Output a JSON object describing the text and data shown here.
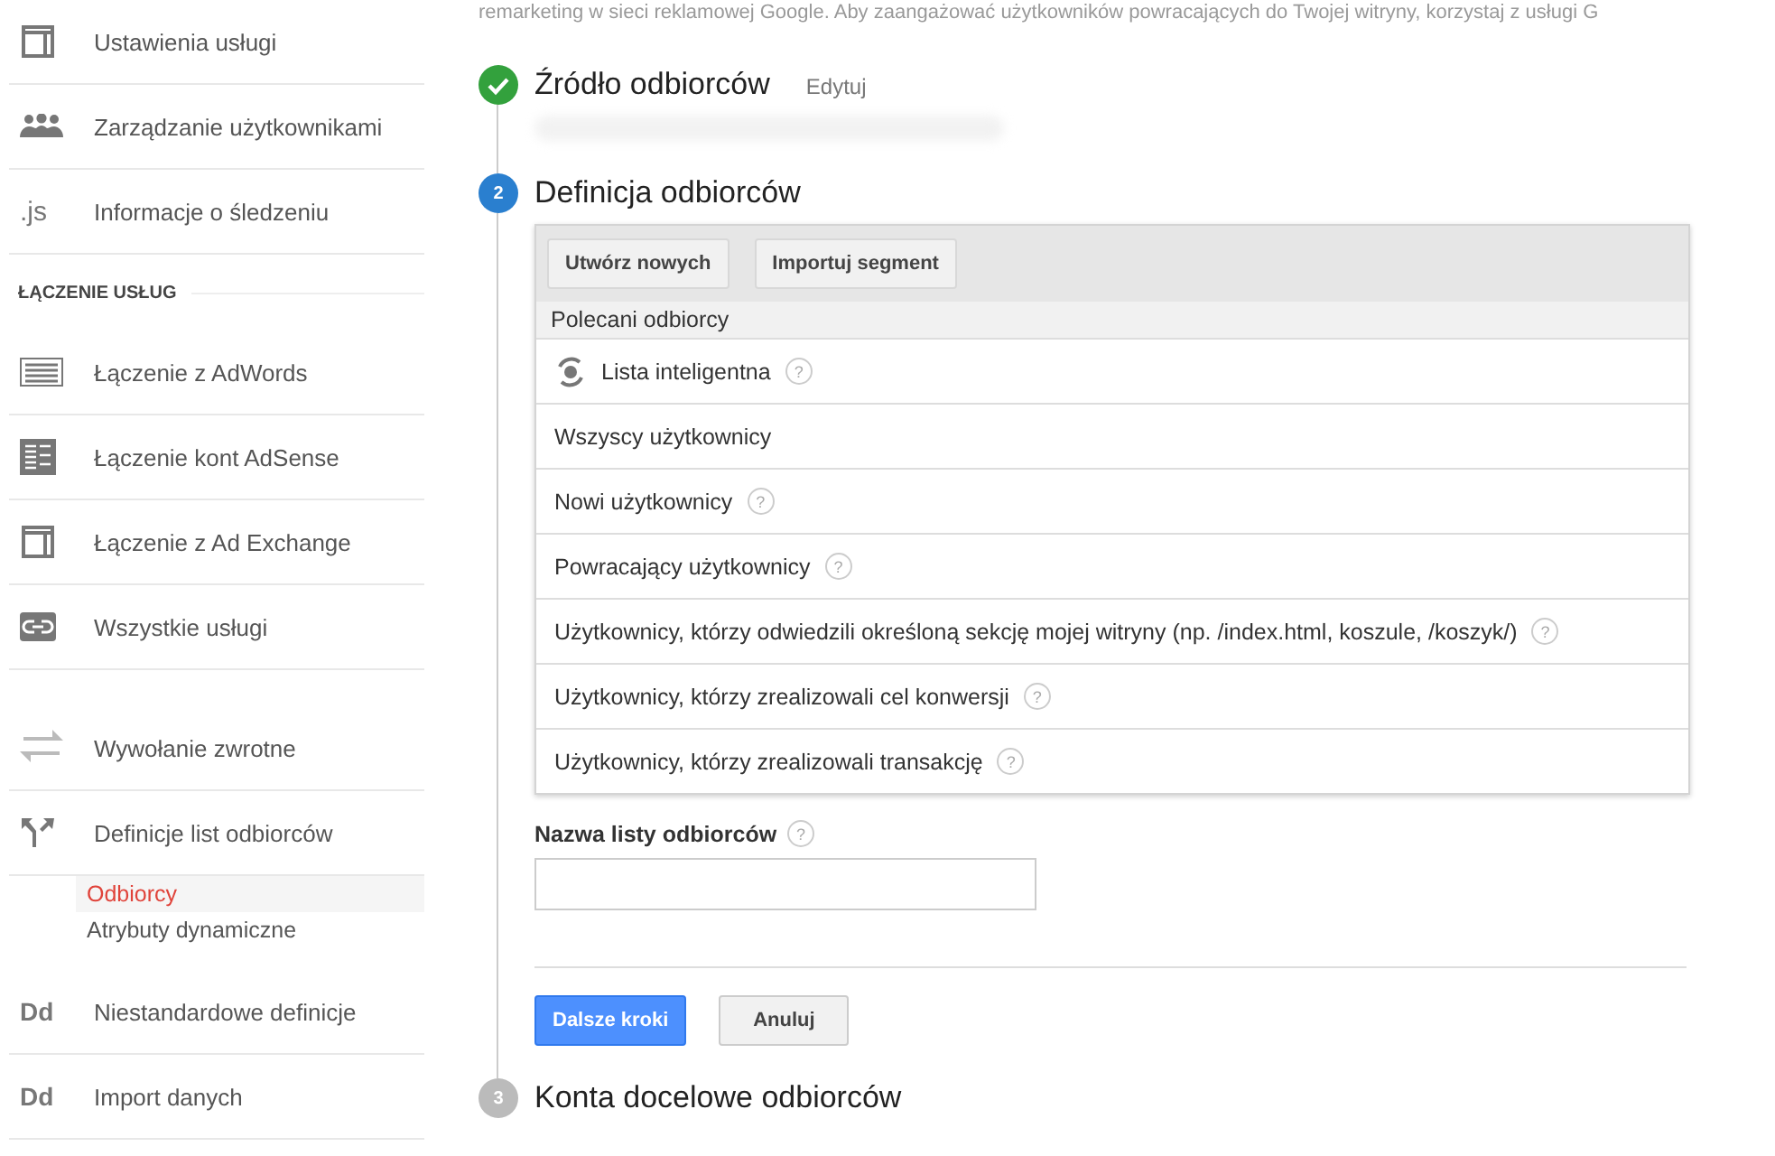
{
  "sidebar": {
    "items": [
      {
        "label": "Ustawienia usługi",
        "kind": "panel"
      },
      {
        "label": "Zarządzanie użytkownikami",
        "kind": "users"
      },
      {
        "label": "Informacje o śledzeniu",
        "kind": "js",
        "icon_text": ".js"
      },
      {
        "kind": "header",
        "label": "ŁĄCZENIE USŁUG"
      },
      {
        "label": "Łączenie z AdWords",
        "kind": "adwords"
      },
      {
        "label": "Łączenie kont AdSense",
        "kind": "adsense"
      },
      {
        "label": "Łączenie z Ad Exchange",
        "kind": "panel"
      },
      {
        "label": "Wszystkie usługi",
        "kind": "link"
      },
      {
        "kind": "spacer"
      },
      {
        "label": "Wywołanie zwrotne",
        "kind": "arrows"
      },
      {
        "label": "Definicje list odbiorców",
        "kind": "fork",
        "children": [
          {
            "label": "Odbiorcy",
            "selected": true
          },
          {
            "label": "Atrybuty dynamiczne",
            "selected": false
          }
        ]
      },
      {
        "label": "Niestandardowe definicje",
        "kind": "dd",
        "icon_text": "Dd"
      },
      {
        "label": "Import danych",
        "kind": "dd",
        "icon_text": "Dd"
      }
    ]
  },
  "intro_text": "remarketing w sieci reklamowej Google. Aby zaangażować użytkowników powracających do Twojej witryny, korzystaj z usługi G",
  "steps": [
    {
      "kind": "done",
      "title": "Źródło odbiorców",
      "edit_link": "Edytuj"
    },
    {
      "kind": "current",
      "number": "2",
      "title": "Definicja odbiorców"
    },
    {
      "kind": "pending",
      "number": "3",
      "title": "Konta docelowe odbiorców"
    }
  ],
  "audience_picker": {
    "buttons": [
      "Utwórz nowych",
      "Importuj segment"
    ],
    "section": "Polecani odbiorcy",
    "rows": [
      {
        "label": "Lista inteligentna",
        "kind": "smart",
        "help": "?"
      },
      {
        "label": "Wszyscy użytkownicy",
        "kind": "plain"
      },
      {
        "label": "Nowi użytkownicy",
        "kind": "plain",
        "help": "?"
      },
      {
        "label": "Powracający użytkownicy",
        "kind": "plain",
        "help": "?"
      },
      {
        "label": "Użytkownicy, którzy odwiedzili określoną sekcję mojej witryny (np. /index.html, koszule, /koszyk/)",
        "kind": "plain",
        "help": "?"
      },
      {
        "label": "Użytkownicy, którzy zrealizowali cel konwersji",
        "kind": "plain",
        "help": "?"
      },
      {
        "label": "Użytkownicy, którzy zrealizowali transakcję",
        "kind": "plain",
        "help": "?"
      }
    ]
  },
  "name_field": {
    "label": "Nazwa listy odbiorców",
    "help": "?"
  },
  "actions": {
    "primary": "Dalsze kroki",
    "secondary": "Anuluj"
  }
}
